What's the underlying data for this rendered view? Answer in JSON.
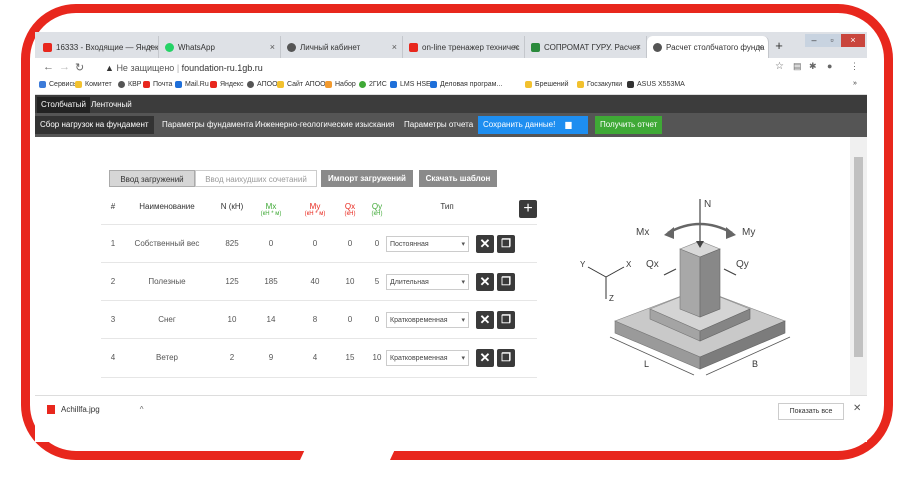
{
  "browser": {
    "tabs": [
      {
        "label": "16333 - Входящие — Яндекс",
        "favicon_color": "#e8271d"
      },
      {
        "label": "WhatsApp",
        "favicon_color": "#25d366"
      },
      {
        "label": "Личный кабинет",
        "favicon_color": "#555555"
      },
      {
        "label": "on-line тренажер техничес",
        "favicon_color": "#e8271d"
      },
      {
        "label": "СОПРОМАТ ГУРУ. Расчет",
        "favicon_color": "#2a8a3c"
      },
      {
        "label": "Расчет столбчатого фунда",
        "favicon_color": "#555555"
      }
    ],
    "address_security": "Не защищено",
    "address_url": "foundation-ru.1gb.ru",
    "bookmarks": [
      "Сервисы",
      "Комитет",
      "КВР",
      "Почта",
      "Mail.Ru",
      "Яндекс",
      "АПОО",
      "Сайт АПОО",
      "Набор",
      "2ГИС",
      "LMS HSE",
      "Деловая програм...",
      "Брешений",
      "Госзакупки",
      "ASUS X553MA"
    ]
  },
  "sheet_tabs": [
    "Столбчатый",
    "Ленточный"
  ],
  "toolbar": {
    "items": [
      "Сбор нагрузок на фундамент",
      "Параметры фундамента",
      "Инженерно-геологические изыскания",
      "Параметры отчета"
    ],
    "save_label": "Сохранить данные!",
    "report_label": "Получить отчет"
  },
  "mode_switch": {
    "input_label": "Ввод загружений",
    "combo_label": "Ввод наихудших сочетаний"
  },
  "import_label": "Импорт загружений",
  "template_label": "Скачать шаблон",
  "table": {
    "headers": {
      "num": "#",
      "name": "Наименование",
      "n": "N (кН)",
      "mx": "Mx",
      "mx_unit": "(кН * м)",
      "my": "My",
      "my_unit": "(кН * м)",
      "qx": "Qx",
      "qx_unit": "(кН)",
      "qy": "Qy",
      "qy_unit": "(кН)",
      "type": "Тип"
    },
    "rows": [
      {
        "num": "1",
        "name": "Собственный вес",
        "n": "825",
        "mx": "0",
        "my": "0",
        "qx": "0",
        "qy": "0",
        "type": "Постоянная"
      },
      {
        "num": "2",
        "name": "Полезные",
        "n": "125",
        "mx": "185",
        "my": "40",
        "qx": "10",
        "qy": "5",
        "type": "Длительная"
      },
      {
        "num": "3",
        "name": "Снег",
        "n": "10",
        "mx": "14",
        "my": "8",
        "qx": "0",
        "qy": "0",
        "type": "Кратковременная"
      },
      {
        "num": "4",
        "name": "Ветер",
        "n": "2",
        "mx": "9",
        "my": "4",
        "qx": "15",
        "qy": "10",
        "type": "Кратковременная"
      }
    ]
  },
  "figure_labels": {
    "n": "N",
    "mx": "Mx",
    "my": "My",
    "qx": "Qx",
    "qy": "Qy",
    "x": "X",
    "y": "Y",
    "z": "Z",
    "l": "L",
    "b": "B"
  },
  "downloads": {
    "file": "Achillfa.jpg",
    "show_all": "Показать все"
  },
  "colors": {
    "accent_frame": "#e8271d",
    "save_button": "#1e8ef0",
    "report_button": "#3fa936",
    "mx_header": "#3fa936",
    "my_header": "#e8271d"
  }
}
